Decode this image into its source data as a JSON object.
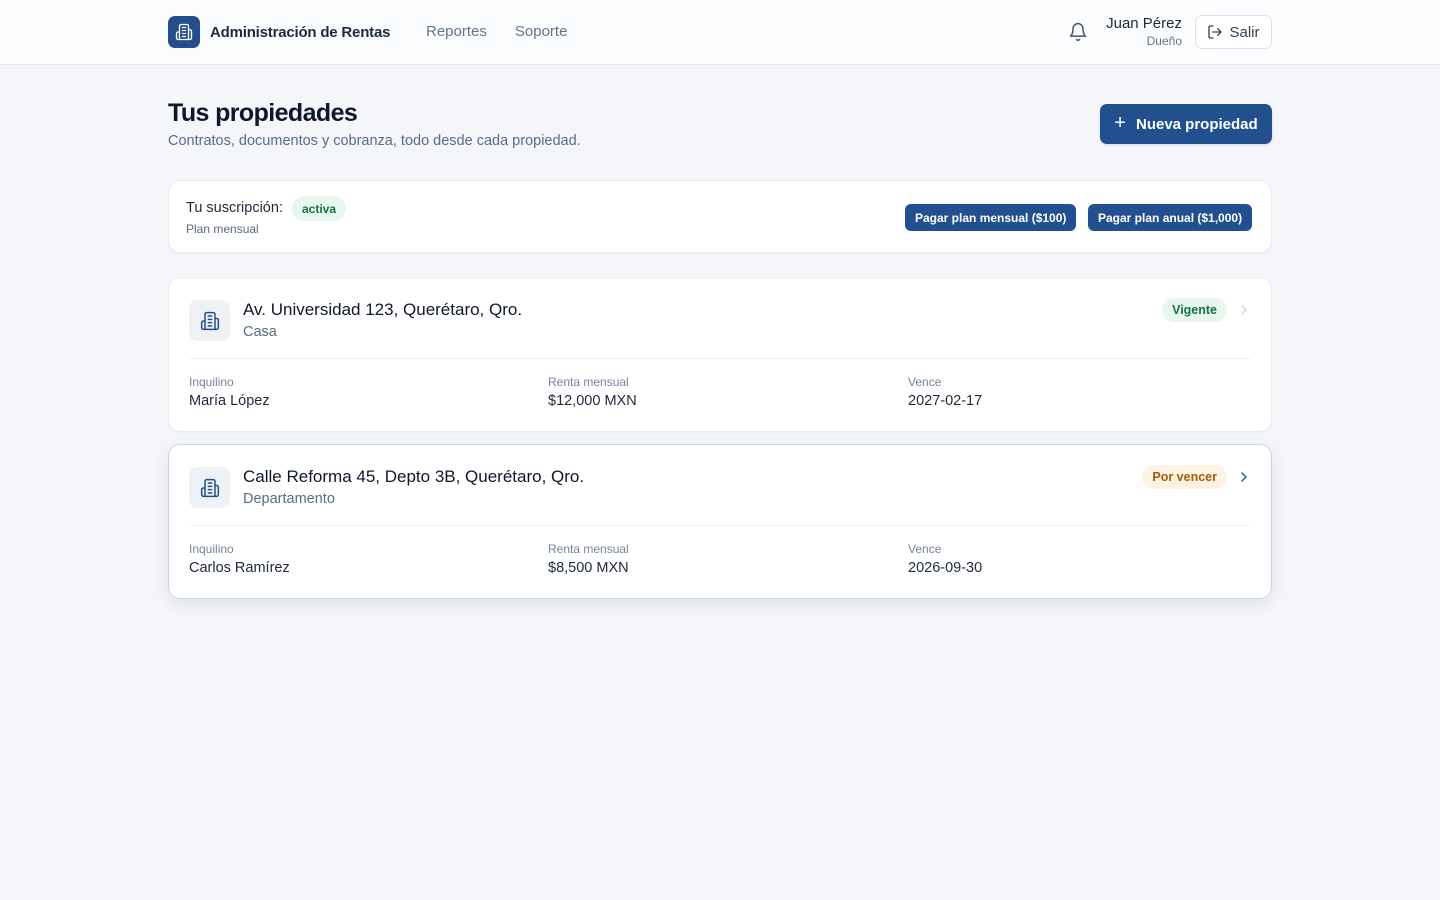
{
  "app": {
    "title": "Administración de Rentas"
  },
  "nav": {
    "items": [
      {
        "label": "Reportes"
      },
      {
        "label": "Soporte"
      }
    ]
  },
  "user": {
    "name": "Juan Pérez",
    "role": "Dueño"
  },
  "header": {
    "logout_label": "Salir",
    "icons": [
      "building-icon",
      "bell-icon",
      "logout-icon"
    ]
  },
  "page": {
    "title": "Tus propiedades",
    "subtitle": "Contratos, documentos y cobranza, todo desde cada propiedad.",
    "new_button": "Nueva propiedad"
  },
  "subscription": {
    "label": "Tu suscripción:",
    "status": "activa",
    "plan": "Plan mensual",
    "monthly_button": "Pagar plan mensual ($100)",
    "annual_button": "Pagar plan anual ($1,000)"
  },
  "properties": [
    {
      "address": "Av. Universidad 123, Querétaro, Qro.",
      "type": "Casa",
      "status": "Vigente",
      "tenant_label": "Inquilino",
      "tenant": "María López",
      "rent_label": "Renta mensual",
      "rent": "$12,000 MXN",
      "due_label": "Vence",
      "due": "2027-02-17"
    },
    {
      "address": "Calle Reforma 45, Depto 3B, Querétaro, Qro.",
      "type": "Departamento",
      "status": "Por vencer",
      "tenant_label": "Inquilino",
      "tenant": "Carlos Ramírez",
      "rent_label": "Renta mensual",
      "rent": "$8,500 MXN",
      "due_label": "Vence",
      "due": "2026-09-30"
    }
  ],
  "colors": {
    "primary": "#22508f",
    "background": "#f4f6f9",
    "success_bg": "#e8f7ee",
    "success_text": "#167243",
    "warning_bg": "#fdf3e3",
    "warning_text": "#a85a0c"
  }
}
